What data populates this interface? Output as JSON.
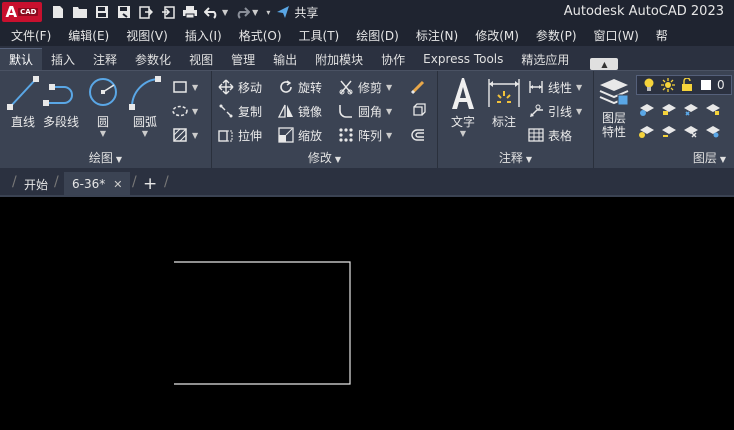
{
  "app": {
    "logo_big": "A",
    "logo_small": "CAD",
    "title": "Autodesk AutoCAD 2023",
    "share_label": "共享"
  },
  "menu": [
    "文件(F)",
    "编辑(E)",
    "视图(V)",
    "插入(I)",
    "格式(O)",
    "工具(T)",
    "绘图(D)",
    "标注(N)",
    "修改(M)",
    "参数(P)",
    "窗口(W)",
    "帮"
  ],
  "ribbon_tabs": [
    "默认",
    "插入",
    "注释",
    "参数化",
    "视图",
    "管理",
    "输出",
    "附加模块",
    "协作",
    "Express Tools",
    "精选应用"
  ],
  "active_tab": "默认",
  "panels": {
    "draw": {
      "title": "绘图",
      "line": "直线",
      "polyline": "多段线",
      "circle": "圆",
      "arc": "圆弧"
    },
    "modify": {
      "title": "修改",
      "move": "移动",
      "rotate": "旋转",
      "trim": "修剪",
      "copy": "复制",
      "mirror": "镜像",
      "fillet": "圆角",
      "stretch": "拉伸",
      "scale": "缩放",
      "array": "阵列"
    },
    "annotation": {
      "title": "注释",
      "text": "文字",
      "dimension": "标注",
      "linear": "线性",
      "leader": "引线",
      "table": "表格"
    },
    "layers": {
      "title": "图层",
      "properties_line1": "图层",
      "properties_line2": "特性",
      "current_layer": "0"
    }
  },
  "file_tabs": {
    "start": "开始",
    "active": "6-36*",
    "close": "✕",
    "add": "+"
  },
  "colors": {
    "accent_red": "#c8102e",
    "ribbon_bg": "#3b4353",
    "titlebar_bg": "#1f2430",
    "canvas_bg": "#000000"
  }
}
